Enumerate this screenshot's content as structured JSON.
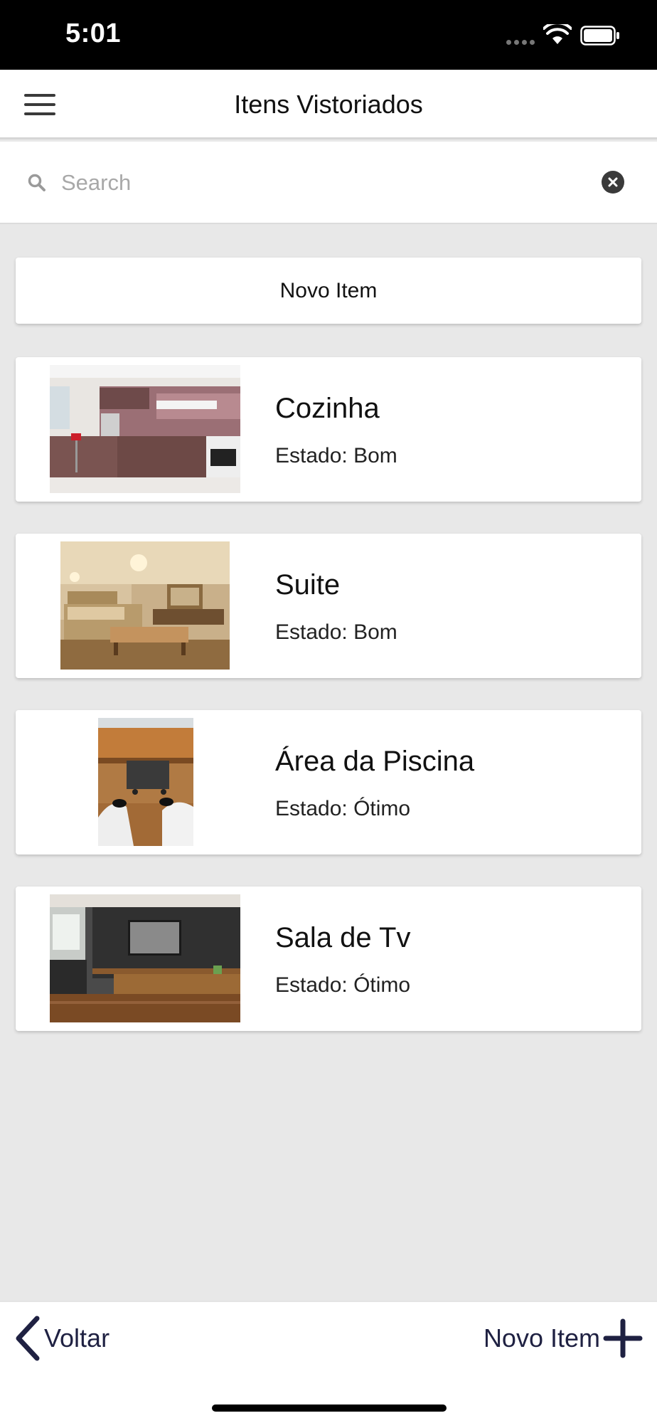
{
  "status_bar": {
    "time": "5:01"
  },
  "header": {
    "title": "Itens Vistoriados"
  },
  "search": {
    "placeholder": "Search",
    "value": ""
  },
  "new_item_card": {
    "label": "Novo Item"
  },
  "items": [
    {
      "name": "Cozinha",
      "state": "Estado: Bom"
    },
    {
      "name": "Suite",
      "state": "Estado: Bom"
    },
    {
      "name": "Área da Piscina",
      "state": "Estado: Ótimo"
    },
    {
      "name": "Sala de Tv",
      "state": "Estado: Ótimo"
    }
  ],
  "bottom_bar": {
    "back_label": "Voltar",
    "new_item_label": "Novo Item"
  },
  "colors": {
    "accent": "#1f2142",
    "background": "#e8e8e8",
    "card": "#ffffff"
  },
  "icons": [
    "menu-icon",
    "search-icon",
    "clear-icon",
    "chevron-left-icon",
    "plus-icon",
    "wifi-icon",
    "battery-icon"
  ]
}
